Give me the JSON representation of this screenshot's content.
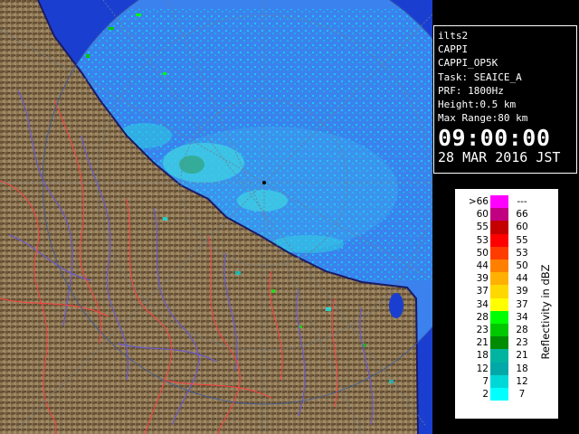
{
  "info": {
    "station": "ilts2",
    "product": "CAPPI",
    "product_name": "CAPPI_OP5K",
    "task": "Task: SEAICE_A",
    "prf": "PRF: 1800Hz",
    "height": "Height:0.5 km",
    "max_range": "Max Range:80 km",
    "time": "09:00:00",
    "date": "28 MAR 2016 JST"
  },
  "legend": {
    "title": "Reflectivity in dBZ",
    "rows": [
      {
        "lo": ">66",
        "hi": "---",
        "color": "#ff00ff"
      },
      {
        "lo": "60",
        "hi": "66",
        "color": "#c00080"
      },
      {
        "lo": "55",
        "hi": "60",
        "color": "#c40000"
      },
      {
        "lo": "53",
        "hi": "55",
        "color": "#ff0000"
      },
      {
        "lo": "50",
        "hi": "53",
        "color": "#ff3c00"
      },
      {
        "lo": "44",
        "hi": "50",
        "color": "#ff8000"
      },
      {
        "lo": "39",
        "hi": "44",
        "color": "#ffb000"
      },
      {
        "lo": "37",
        "hi": "39",
        "color": "#ffd800"
      },
      {
        "lo": "34",
        "hi": "37",
        "color": "#ffff00"
      },
      {
        "lo": "28",
        "hi": "34",
        "color": "#00ff00"
      },
      {
        "lo": "23",
        "hi": "28",
        "color": "#00c800"
      },
      {
        "lo": "21",
        "hi": "23",
        "color": "#008c00"
      },
      {
        "lo": "18",
        "hi": "21",
        "color": "#00b4a0"
      },
      {
        "lo": "12",
        "hi": "18",
        "color": "#00a8a8"
      },
      {
        "lo": "7",
        "hi": "12",
        "color": "#00d8d8"
      },
      {
        "lo": "2",
        "hi": "7",
        "color": "#00ffff"
      }
    ]
  },
  "colors": {
    "sea": "#1a3fd0",
    "radar_disc": "#3b82ee",
    "land": "#8a7452",
    "coast": "#1a1a66",
    "rivers": "#6a5acd",
    "borders": "#ff4040",
    "grid": "#6e7e90"
  }
}
